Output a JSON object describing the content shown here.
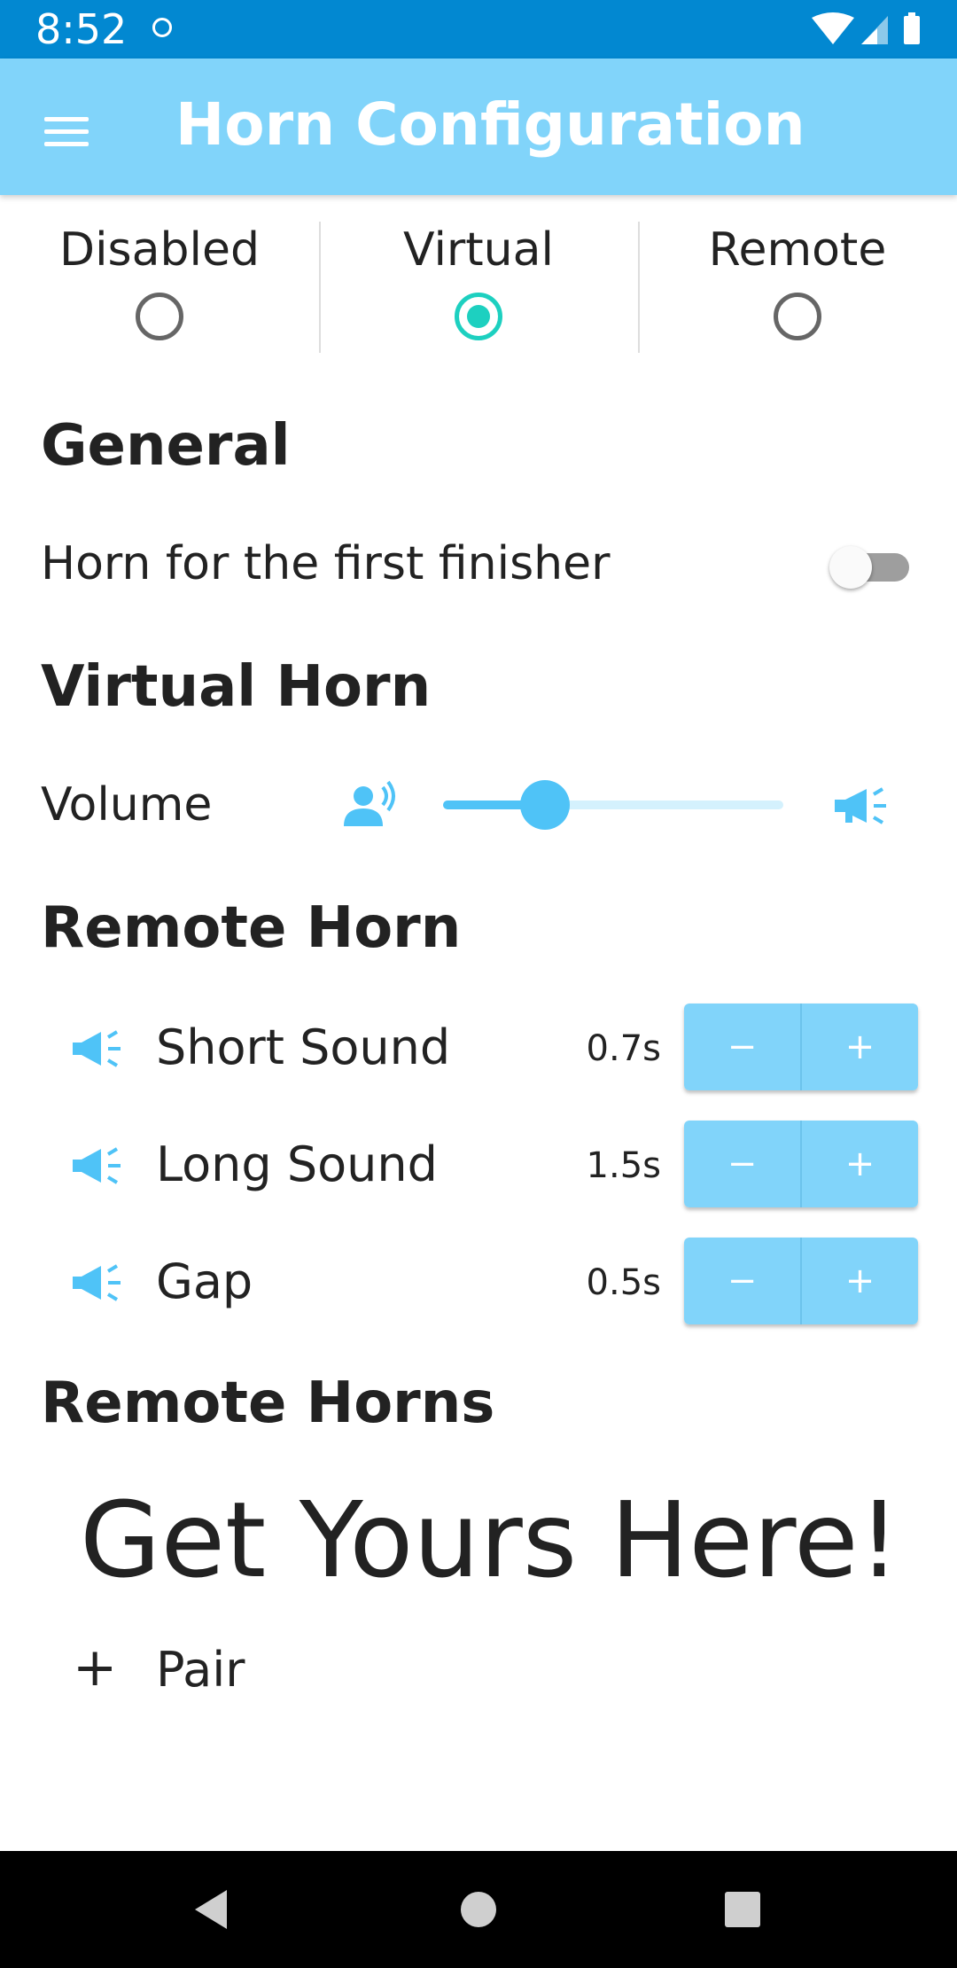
{
  "status_bar": {
    "time": "8:52"
  },
  "app_bar": {
    "title": "Horn Configuration"
  },
  "modes": [
    {
      "label": "Disabled",
      "selected": false
    },
    {
      "label": "Virtual",
      "selected": true
    },
    {
      "label": "Remote",
      "selected": false
    }
  ],
  "general": {
    "title": "General",
    "first_finisher_label": "Horn for the first finisher",
    "first_finisher_enabled": false
  },
  "virtual_horn": {
    "title": "Virtual Horn",
    "volume_label": "Volume",
    "volume_level": 0.3
  },
  "remote_horn": {
    "title": "Remote Horn",
    "rows": [
      {
        "label": "Short Sound",
        "value": "0.7s",
        "minus": "−",
        "plus": "+"
      },
      {
        "label": "Long Sound",
        "value": "1.5s",
        "minus": "−",
        "plus": "+"
      },
      {
        "label": "Gap",
        "value": "0.5s",
        "minus": "−",
        "plus": "+"
      }
    ]
  },
  "remote_horns": {
    "title": "Remote Horns",
    "promo": "Get Yours Here!",
    "pair_icon": "+",
    "pair_label": "Pair"
  },
  "colors": {
    "status_bar": "#0288d1",
    "app_bar": "#81d4fa",
    "accent": "#1dd0c0",
    "icon_blue": "#4fc3f7"
  }
}
